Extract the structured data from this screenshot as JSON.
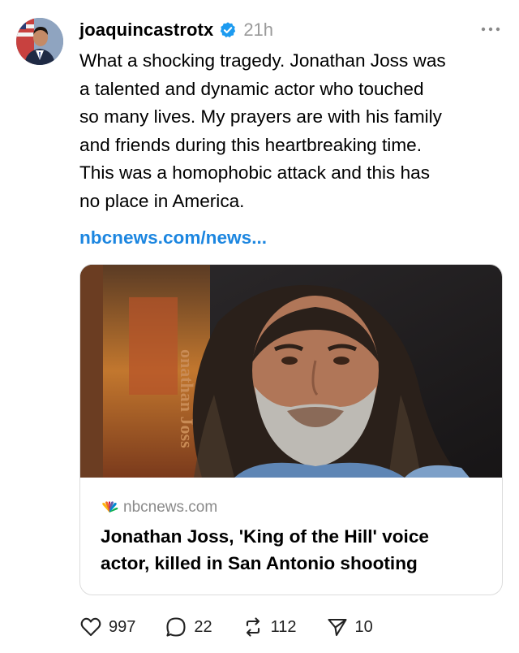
{
  "post": {
    "username": "joaquincastrotx",
    "time": "21h",
    "text": "What a shocking tragedy. Jonathan Joss was\na talented and dynamic actor who touched\nso many lives. My prayers are with his family\nand friends during this heartbreaking time.\nThis was a homophobic attack and this has\nno place in America.",
    "link": "nbcnews.com/news..."
  },
  "card": {
    "image_sign_text": "onathan Joss",
    "domain": "nbcnews.com",
    "title": "Jonathan Joss, 'King of the Hill' voice actor, killed in San Antonio shooting"
  },
  "actions": {
    "likes": "997",
    "replies": "22",
    "reposts": "112",
    "shares": "10"
  },
  "icons": {
    "verified": "verified-badge-icon",
    "more": "more-options-icon",
    "like": "heart-icon",
    "reply": "comment-bubble-icon",
    "repost": "repost-icon",
    "share": "share-send-icon",
    "source": "nbc-peacock-icon"
  },
  "colors": {
    "link": "#1c86e0",
    "verified": "#1d9bf0",
    "muted": "#9a9a9a"
  }
}
